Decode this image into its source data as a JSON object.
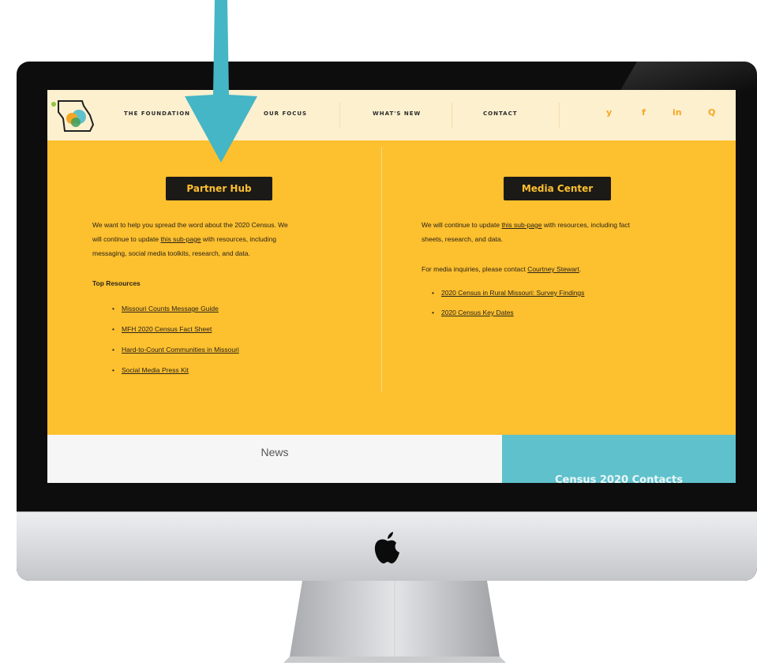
{
  "nav": {
    "links": [
      "THE FOUNDATION",
      "OUR FOCUS",
      "WHAT'S NEW",
      "CONTACT"
    ],
    "social": {
      "twitter": "y",
      "facebook": "f",
      "linkedin": "in",
      "search": "Q"
    }
  },
  "partner_hub": {
    "title": "Partner Hub",
    "intro_1": "We want to help you spread the word about the 2020 Census. We",
    "intro_2a": "will continue to update ",
    "intro_2_link": "this sub-page",
    "intro_2b": " with resources, including",
    "intro_3": "messaging, social media toolkits, research, and data.",
    "top_resources_label": "Top Resources",
    "resources": [
      "Missouri Counts Message Guide",
      "MFH 2020 Census Fact Sheet",
      "Hard-to-Count Communities in Missouri",
      "Social Media Press Kit"
    ]
  },
  "media_center": {
    "title": "Media Center",
    "intro_1a": "We will continue to update ",
    "intro_1_link": "this sub-page",
    "intro_1b": " with resources, including fact",
    "intro_2": "sheets, research, and data.",
    "contact_text": "For media inquiries, please contact ",
    "contact_link": "Courtney Stewart",
    "contact_end": ".",
    "links": [
      "2020 Census in Rural Missouri: Survey Findings",
      "2020 Census Key Dates"
    ]
  },
  "news": {
    "title": "News"
  },
  "contacts": {
    "title": "Census 2020 Contacts"
  },
  "colors": {
    "arrow": "#45b6c5",
    "page_background": "#fdc02f",
    "nav_background": "#fdf0cf",
    "button_background": "#1c1a17",
    "contacts_band": "#5fc1cc",
    "social_icon": "#f5a623"
  },
  "icons": [
    "down-arrow-icon",
    "apple-logo-icon",
    "missouri-logo",
    "twitter-icon",
    "facebook-icon",
    "linkedin-icon",
    "search-icon"
  ]
}
